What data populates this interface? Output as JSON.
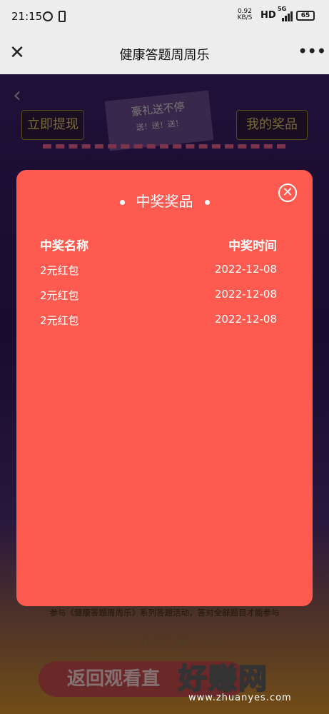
{
  "status_bar": {
    "time": "21:15",
    "net_speed": "0.92",
    "net_unit": "KB/S",
    "hd": "HD",
    "network": "5G",
    "battery": "65"
  },
  "nav": {
    "title": "健康答题周周乐",
    "close_icon": "close-icon",
    "more_icon": "more-icon"
  },
  "background": {
    "withdraw_label": "立即提现",
    "my_prizes_label": "我的奖品",
    "flag_text": "豪礼送不停",
    "flag_sub": "送！送！送！",
    "footer_text": "参与《健康答题周周乐》系列答题活动，答对全部题目才能参与",
    "winners_title": "中奖名单",
    "live_button_label": "返回观看直"
  },
  "modal": {
    "title": "中奖奖品",
    "headers": {
      "name": "中奖名称",
      "time": "中奖时间"
    },
    "rows": [
      {
        "name": "2元红包",
        "time": "2022-12-08"
      },
      {
        "name": "2元红包",
        "time": "2022-12-08"
      },
      {
        "name": "2元红包",
        "time": "2022-12-08"
      }
    ]
  },
  "watermark": {
    "big": "好赚网",
    "small": "www.zhuanyes.com"
  },
  "colors": {
    "modal_bg": "#fe5a4f",
    "navbar_bg": "#ededed"
  }
}
